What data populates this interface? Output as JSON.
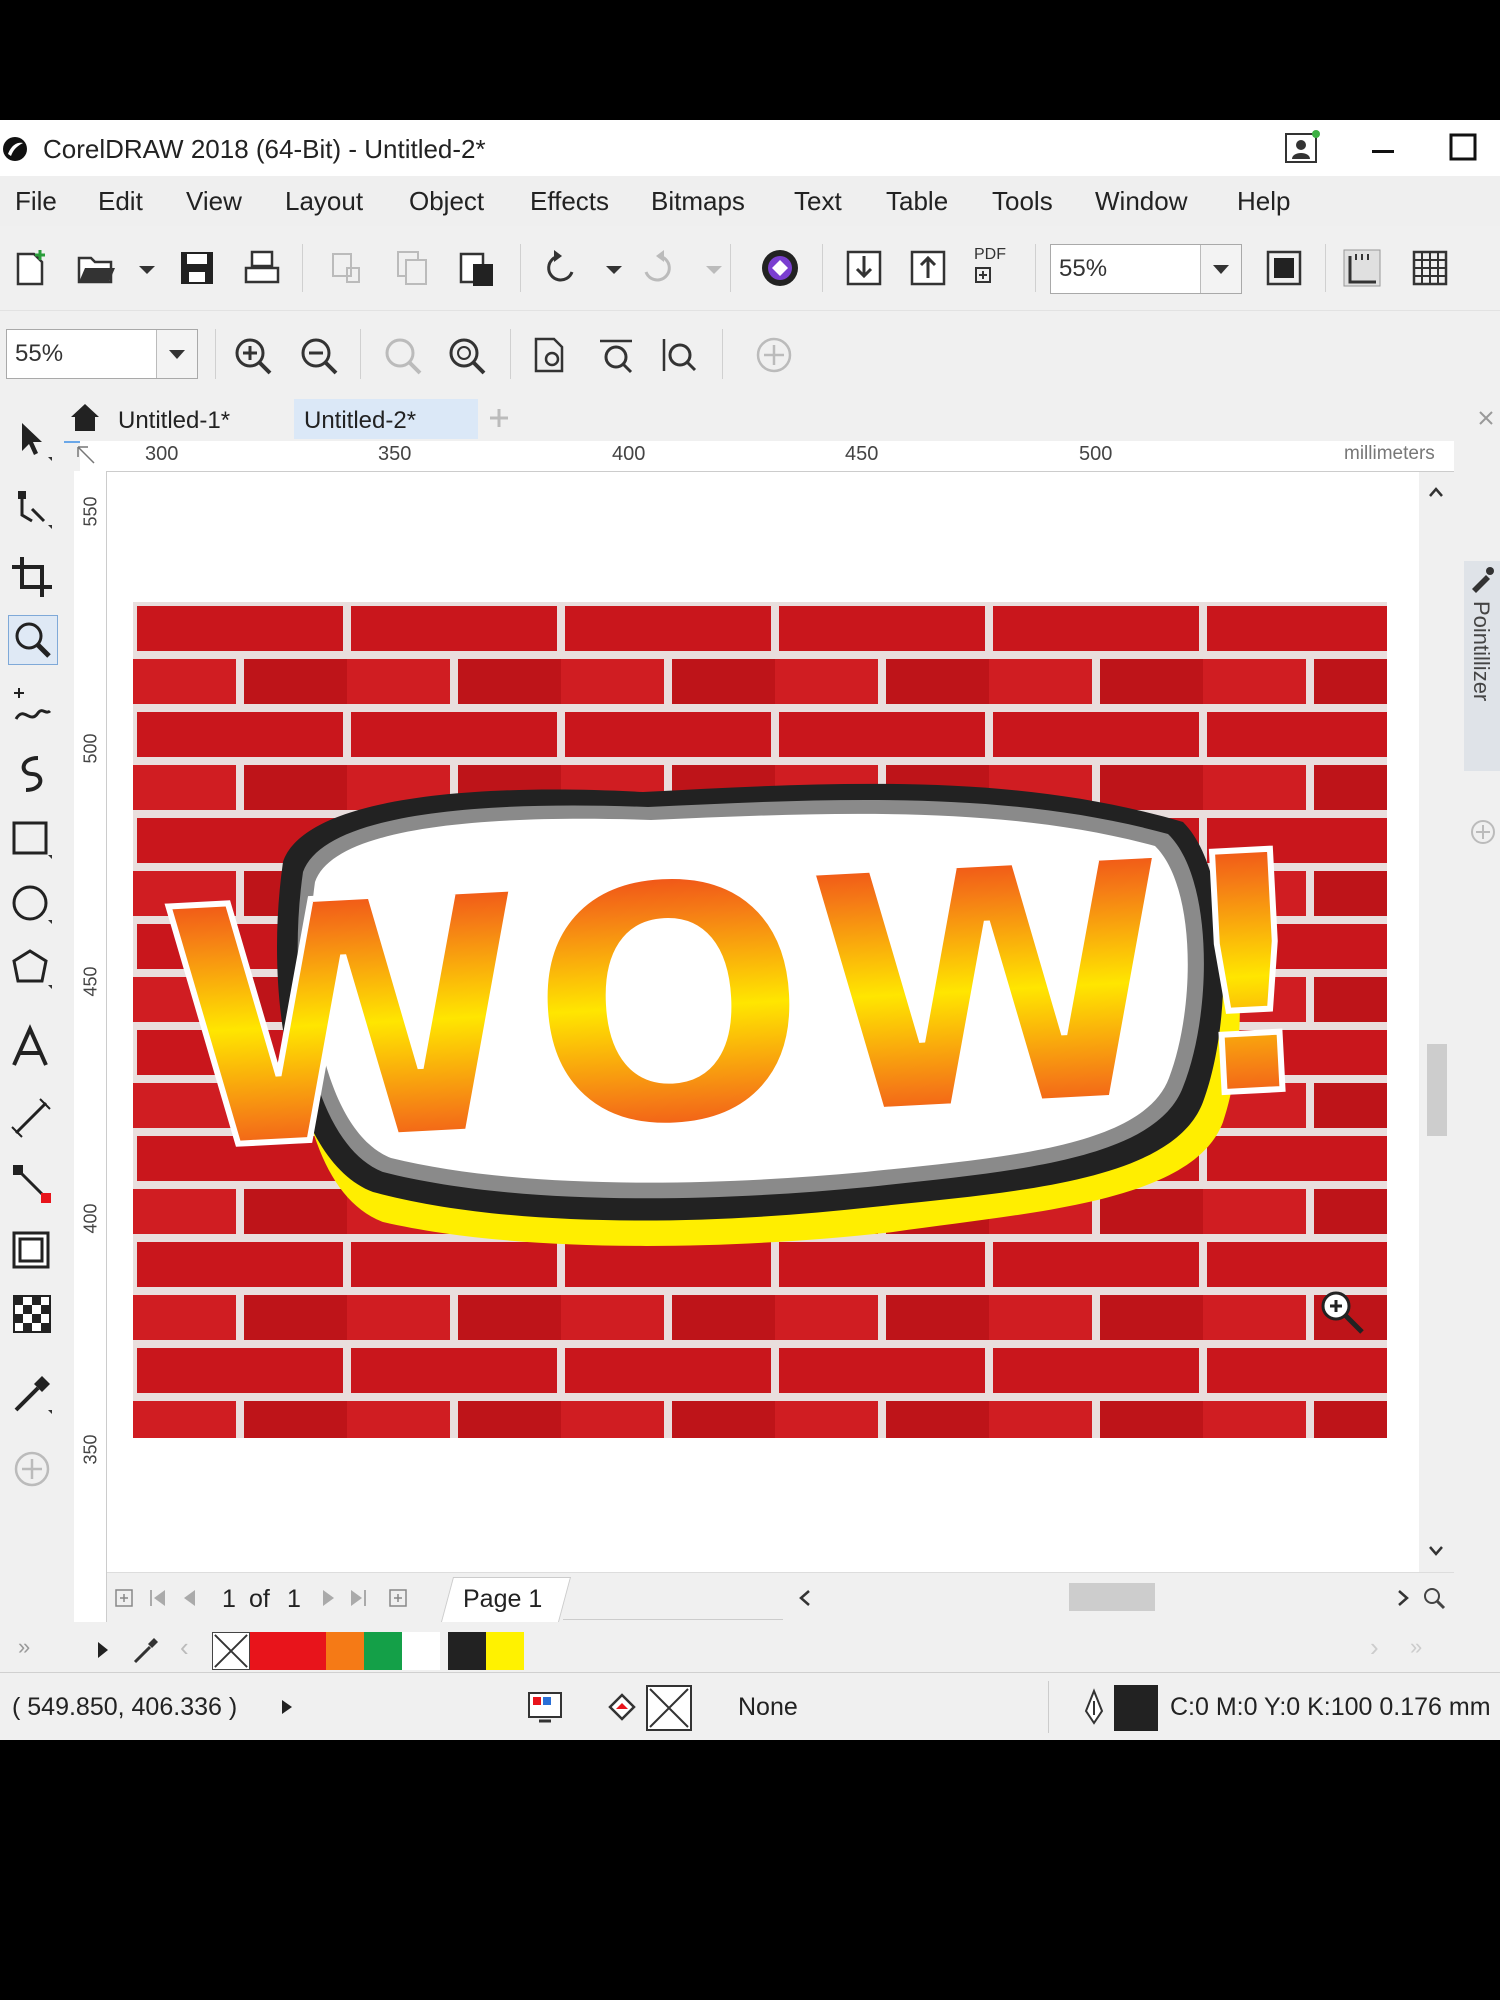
{
  "window": {
    "title": "CorelDRAW 2018 (64-Bit) - Untitled-2*"
  },
  "menu": [
    "File",
    "Edit",
    "View",
    "Layout",
    "Object",
    "Effects",
    "Bitmaps",
    "Text",
    "Table",
    "Tools",
    "Window",
    "Help"
  ],
  "standard_toolbar": {
    "zoom_value": "55%",
    "pdf_label": "PDF"
  },
  "property_bar": {
    "zoom_value": "55%"
  },
  "tabs": [
    {
      "label": "Untitled-1*",
      "active": false
    },
    {
      "label": "Untitled-2*",
      "active": true
    }
  ],
  "ruler": {
    "top_ticks": [
      "300",
      "350",
      "400",
      "450",
      "500"
    ],
    "left_ticks": [
      "550",
      "500",
      "450",
      "400",
      "350"
    ],
    "units": "millimeters"
  },
  "artwork": {
    "text": "WOW!",
    "gradient_colors": [
      "#e8141b",
      "#f57a16",
      "#ffe600"
    ],
    "shadow_color": "#ffee00",
    "outline_color": "#222222",
    "brick_color": "#c9161c",
    "mortar_color": "#e9dedd"
  },
  "docker": {
    "label": "Pointillizer"
  },
  "page_nav": {
    "current": "1",
    "of_label": "of",
    "total": "1",
    "page_tab": "Page 1"
  },
  "palette": {
    "colors": [
      "#e8141b",
      "#e8141b",
      "#f57a16",
      "#14a048",
      "#ffffff",
      "#222222",
      "#fff200"
    ]
  },
  "status": {
    "coordinates": "( 549.850, 406.336 )",
    "fill_label": "None",
    "outline_info": "C:0 M:0 Y:0 K:100  0.176 mm"
  }
}
